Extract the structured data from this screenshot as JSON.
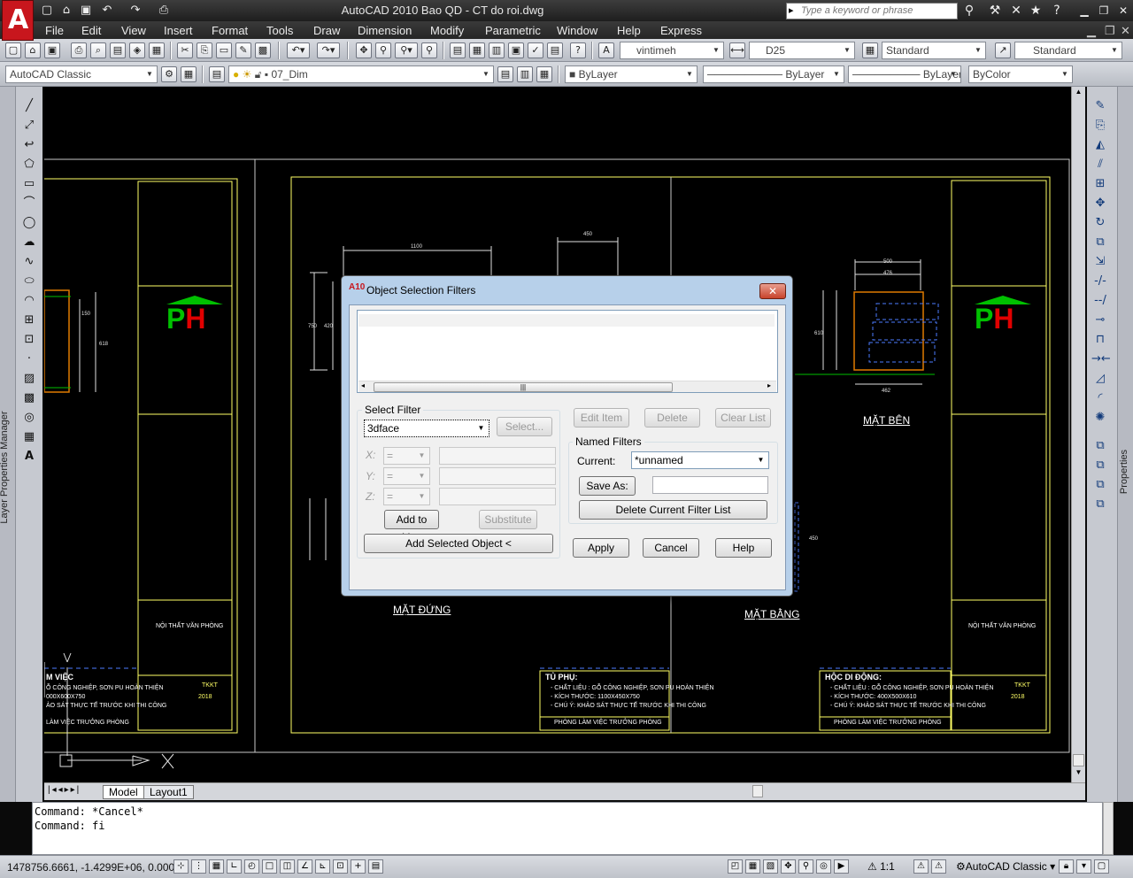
{
  "window": {
    "title": "AutoCAD 2010    Bao QD - CT do roi.dwg",
    "search_placeholder": "Type a keyword or phrase",
    "logo_letter": "A"
  },
  "menubar": [
    "File",
    "Edit",
    "View",
    "Insert",
    "Format",
    "Tools",
    "Draw",
    "Dimension",
    "Modify",
    "Parametric",
    "Window",
    "Help",
    "Express"
  ],
  "toolbar": {
    "text_style": "vintimeh",
    "dim_style": "D25",
    "table_style": "Standard",
    "multileader_style": "Standard",
    "workspace": "AutoCAD Classic",
    "layer": "07_Dim",
    "color": "ByLayer",
    "linetype": "ByLayer",
    "lineweight": "ByLayer",
    "plotstyle": "ByColor"
  },
  "palettes": {
    "left_label": "Layer Properties Manager",
    "right_label": "Properties"
  },
  "drawing": {
    "logo_text": "PH",
    "view_labels": {
      "front": "MẶT ĐỨNG",
      "side": "MẶT BÊN",
      "plan": "MẶT BẰNG"
    },
    "notes": {
      "tu_phu_title": "TỦ PHỤ:",
      "hoc_di_dong_title": "HỘC DI ĐỘNG:",
      "tu_phu_lines": [
        "- CHẤT LIỆU : GỖ CÔNG NGHIỆP, SƠN PU HOÀN THIỆN",
        "- KÍCH THƯỚC: 1100X450X750",
        "- CHÚ Ý: KHẢO SÁT THỰC TẾ TRƯỚC KHI THI CÔNG"
      ],
      "hoc_lines": [
        "- CHẤT LIỆU : GỖ CÔNG NGHIỆP, SƠN PU HOÀN THIỆN",
        "- KÍCH THƯỚC: 400X500X610",
        "- CHÚ Ý: KHẢO SÁT THỰC TẾ TRƯỚC KHI THI CÔNG"
      ],
      "room": "PHÒNG LÀM VIỆC TRƯỞNG PHÒNG",
      "left_partial_title": "M VIỆC",
      "left_partial_room": "LÀM VIỆC TRƯỞNG PHÒNG",
      "left_partial_lines": [
        "Ỗ CÔNG NGHIỆP, SƠN PU HOÀN THIỆN",
        "000X600X750",
        "ẢO SÁT THỰC TẾ TRƯỚC KHI THI CÔNG"
      ]
    },
    "title_block": {
      "project": "NỘI THẤT VĂN PHÒNG",
      "code": "TKKT",
      "year": "2018"
    },
    "dims": {
      "front_width": "1100",
      "top_width": "450",
      "side_width": "500",
      "side_inner": "476",
      "side_bottom": "462",
      "side_height": "610",
      "front_h1": "750",
      "front_h2": "420",
      "front_h3": "150",
      "front_h4": "618",
      "plan_h": "450"
    },
    "tabs": {
      "model": "Model",
      "layout": "Layout1"
    }
  },
  "dialog": {
    "title": "Object Selection Filters",
    "icon_text": "A10",
    "select_filter_label": "Select Filter",
    "filter_type": "3dface",
    "select_button": "Select...",
    "axes": [
      "X:",
      "Y:",
      "Z:"
    ],
    "operators": [
      "=",
      "=",
      "="
    ],
    "add_to_list": "Add to List:",
    "substitute": "Substitute",
    "add_selected_object": "Add Selected Object <",
    "edit_item": "Edit Item",
    "delete": "Delete",
    "clear_list": "Clear List",
    "named_filters_label": "Named Filters",
    "current_label": "Current:",
    "current_value": "*unnamed",
    "save_as": "Save As:",
    "delete_current": "Delete Current Filter List",
    "apply": "Apply",
    "cancel": "Cancel",
    "help": "Help"
  },
  "command": {
    "lines": [
      "Command: *Cancel*",
      "Command: fi"
    ]
  },
  "status": {
    "coords": "1478756.6661, -1.4299E+06, 0.0000",
    "annotation_scale": "1:1",
    "workspace": "AutoCAD Classic"
  },
  "colors": {
    "background": "#000000",
    "cad_yellow": "#ffff66",
    "cad_green": "#00c000",
    "cad_red": "#e00000",
    "cad_blue": "#4d7cff",
    "dialog_frame": "#b7d0ea"
  }
}
